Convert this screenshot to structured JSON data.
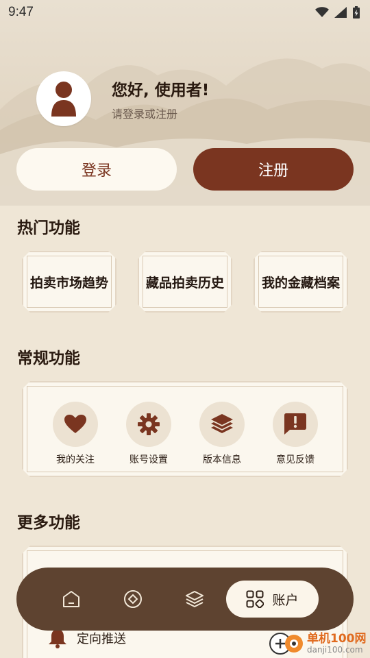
{
  "status_bar": {
    "time": "9:47",
    "icons": [
      "wifi-icon",
      "signal-icon",
      "battery-charging-icon"
    ]
  },
  "profile": {
    "greeting": "您好, 使用者!",
    "subtitle": "请登录或注册",
    "avatar_icon": "user-icon"
  },
  "auth": {
    "login_label": "登录",
    "register_label": "注册"
  },
  "hot_section": {
    "title": "热门功能",
    "items": [
      {
        "label": "拍卖市场趋势"
      },
      {
        "label": "藏品拍卖历史"
      },
      {
        "label": "我的金藏档案"
      }
    ]
  },
  "regular_section": {
    "title": "常规功能",
    "items": [
      {
        "label": "我的关注",
        "icon": "heart-icon"
      },
      {
        "label": "账号设置",
        "icon": "gear-icon"
      },
      {
        "label": "版本信息",
        "icon": "layers-icon"
      },
      {
        "label": "意见反馈",
        "icon": "feedback-icon"
      }
    ]
  },
  "more_section": {
    "title": "更多功能",
    "items": [
      {
        "label": "定向推送",
        "icon": "bell-icon"
      }
    ]
  },
  "bottom_nav": {
    "items": [
      {
        "icon": "home-icon"
      },
      {
        "icon": "compass-icon"
      },
      {
        "icon": "layers-icon"
      },
      {
        "icon": "grid-icon",
        "label": "账户",
        "active": true
      }
    ]
  },
  "watermark": {
    "name": "单机100网",
    "url": "danji100.com"
  },
  "colors": {
    "accent": "#7a3520",
    "nav_bg": "#5e4330",
    "page_bg": "#efe6d6",
    "card_bg": "#fbf7ee"
  }
}
